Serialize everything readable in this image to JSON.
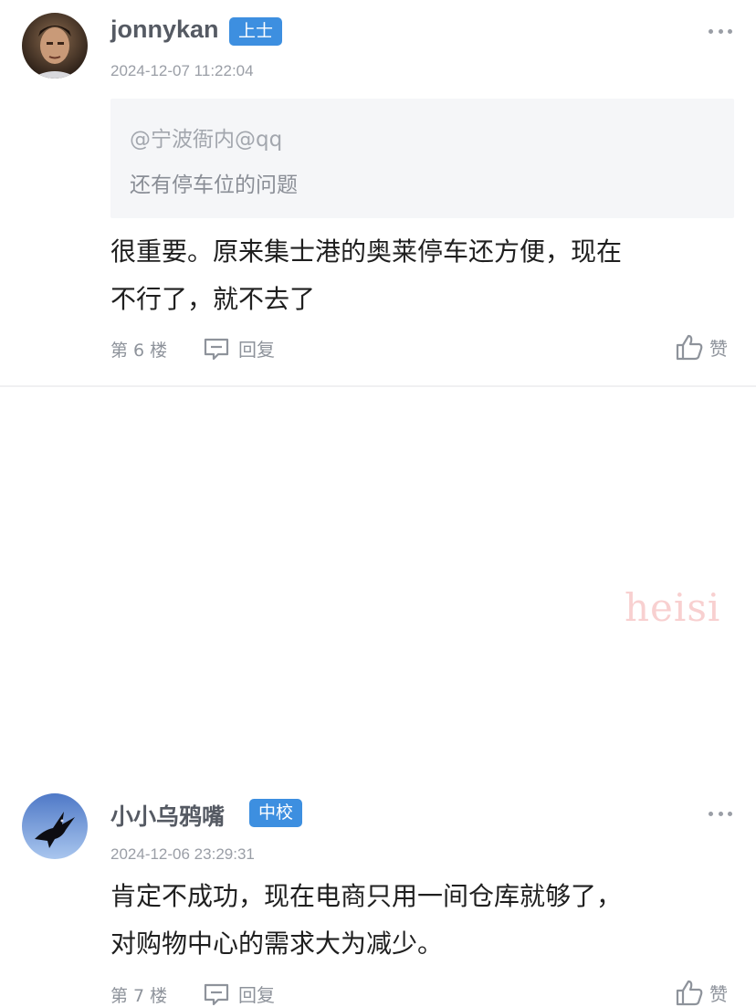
{
  "posts": [
    {
      "username": "jonnykan",
      "rank": "上士",
      "timestamp": "2024-12-07 11:22:04",
      "quote": {
        "mention": "@宁波衙内@qq",
        "text": "还有停车位的问题"
      },
      "body": [
        "很重要。原来集士港的奥莱停车还方便，现在",
        "不行了，就不去了"
      ],
      "floor": "第 6 楼",
      "reply_label": "回复",
      "like_label": "赞"
    },
    {
      "username": "小小乌鸦嘴",
      "rank": "中校",
      "timestamp": "2024-12-06 23:29:31",
      "body": [
        "肯定不成功，现在电商只用一间仓库就够了，",
        "对购物中心的需求大为减少。"
      ],
      "floor": "第 7 楼",
      "reply_label": "回复",
      "like_label": "赞"
    }
  ],
  "watermark": "heisi",
  "colors": {
    "rank_badge": "#3d8fe0",
    "quote_bg": "#f5f6f8",
    "meta_gray": "#9a9ea6"
  }
}
